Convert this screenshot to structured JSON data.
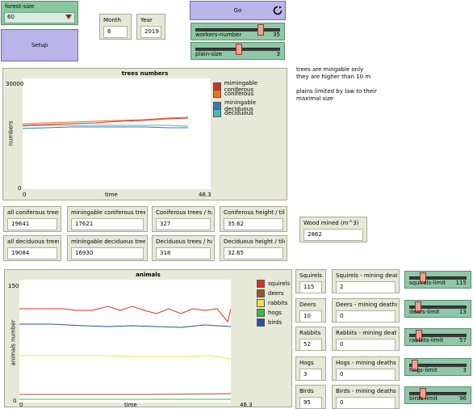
{
  "forest_size": {
    "label": "forest-size",
    "value": "60"
  },
  "setup": {
    "label": "Setup"
  },
  "month": {
    "label": "Month",
    "value": "6"
  },
  "year": {
    "label": "Year",
    "value": "2019"
  },
  "go": {
    "label": "Go"
  },
  "workers_number": {
    "label": "workers-number",
    "value": "35",
    "fraction": 0.78
  },
  "plain_size": {
    "label": "plain-size",
    "value": "3",
    "fraction": 0.5
  },
  "notes": {
    "line1": "trees are mingable only",
    "line2": "they are higher than 10 m",
    "line3": "plains limited by law to their",
    "line4": "maximal size"
  },
  "trees_plot": {
    "title": "trees numbers",
    "ymax": "30000",
    "ymin": "0",
    "xmin": "0",
    "xmax": "46.3",
    "xlabel": "time",
    "ylabel": "numbers",
    "legend": [
      {
        "label": "mimingable coniferous",
        "color": "#d73027"
      },
      {
        "label": "coniferous",
        "color": "#f07020"
      },
      {
        "label": "miningable deciduous",
        "color": "#3a75b5"
      },
      {
        "label": "deciduous",
        "color": "#48b8b8"
      }
    ]
  },
  "monitors_row1": [
    {
      "label": "all coniferous trees",
      "value": "19641"
    },
    {
      "label": "miningable coniferous trees",
      "value": "17621"
    },
    {
      "label": "Coniferous trees / ha",
      "value": "327"
    },
    {
      "label": "Coniferous height / tile",
      "value": "35.62"
    }
  ],
  "monitors_row2": [
    {
      "label": "all deciduous trees",
      "value": "19084"
    },
    {
      "label": "miningable deciduous trees",
      "value": "16930"
    },
    {
      "label": "Deciduous trees / ha",
      "value": "318"
    },
    {
      "label": "Deciduous height / tile",
      "value": "32.65"
    }
  ],
  "wood_mined": {
    "label": "Wood mined (m^3)",
    "value": "2862"
  },
  "animals_plot": {
    "title": "animals",
    "ymax": "150",
    "ymin": "0",
    "xmin": "0",
    "xmax": "46.3",
    "xlabel": "time",
    "ylabel": "animals number",
    "legend": [
      {
        "label": "squirels",
        "color": "#d73027"
      },
      {
        "label": "deers",
        "color": "#a0522d"
      },
      {
        "label": "rabbits",
        "color": "#f0e040"
      },
      {
        "label": "hogs",
        "color": "#33c040"
      },
      {
        "label": "birds",
        "color": "#2a4fa8"
      }
    ]
  },
  "animals": [
    {
      "name": "Squirels",
      "count": "115",
      "death_label": "Squirels - mining death",
      "deaths": "2",
      "limit_label": "squirels-limit",
      "limit": "115",
      "fraction": 0.2
    },
    {
      "name": "Deers",
      "count": "10",
      "death_label": "Deers - mining deaths",
      "deaths": "0",
      "limit_label": "deers-limit",
      "limit": "13",
      "fraction": 0.1
    },
    {
      "name": "Rabbits",
      "count": "52",
      "death_label": "Rabbits - mining death",
      "deaths": "0",
      "limit_label": "rabbits-limit",
      "limit": "57",
      "fraction": 0.12
    },
    {
      "name": "Hogs",
      "count": "3",
      "death_label": "Hogs - mining deaths",
      "deaths": "0",
      "limit_label": "hogs-limit",
      "limit": "3",
      "fraction": 0.04
    },
    {
      "name": "Birds",
      "count": "95",
      "death_label": "Birds - mining deaths",
      "deaths": "0",
      "limit_label": "birds-limit",
      "limit": "96",
      "fraction": 0.2
    }
  ]
}
